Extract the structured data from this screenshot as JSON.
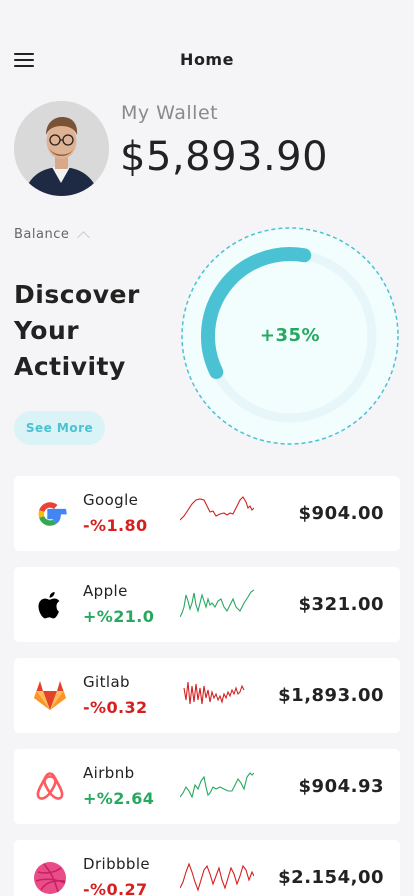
{
  "header": {
    "title": "Home"
  },
  "wallet": {
    "label": "My Wallet",
    "amount": "$5,893.90"
  },
  "balance": {
    "label": "Balance"
  },
  "discover": {
    "heading": "Discover\nYour\nActivity",
    "button": "See More"
  },
  "gauge": {
    "value_text": "+35%",
    "progress_percent": 35
  },
  "colors": {
    "accent": "#4ac2d3",
    "accent_light": "#daf3f7",
    "positive": "#27a85f",
    "negative": "#d61f1f"
  },
  "stocks": [
    {
      "name": "Google",
      "change": "-%1.80",
      "trend": "negative",
      "price": "$904.00",
      "icon": "google-logo-icon"
    },
    {
      "name": "Apple",
      "change": "+%21.0",
      "trend": "positive",
      "price": "$321.00",
      "icon": "apple-logo-icon"
    },
    {
      "name": "Gitlab",
      "change": "-%0.32",
      "trend": "negative",
      "price": "$1,893.00",
      "icon": "gitlab-logo-icon"
    },
    {
      "name": "Airbnb",
      "change": "+%2.64",
      "trend": "positive",
      "price": "$904.93",
      "icon": "airbnb-logo-icon"
    },
    {
      "name": "Dribbble",
      "change": "-%0.27",
      "trend": "negative",
      "price": "$2.154,00",
      "icon": "dribbble-logo-icon"
    }
  ]
}
